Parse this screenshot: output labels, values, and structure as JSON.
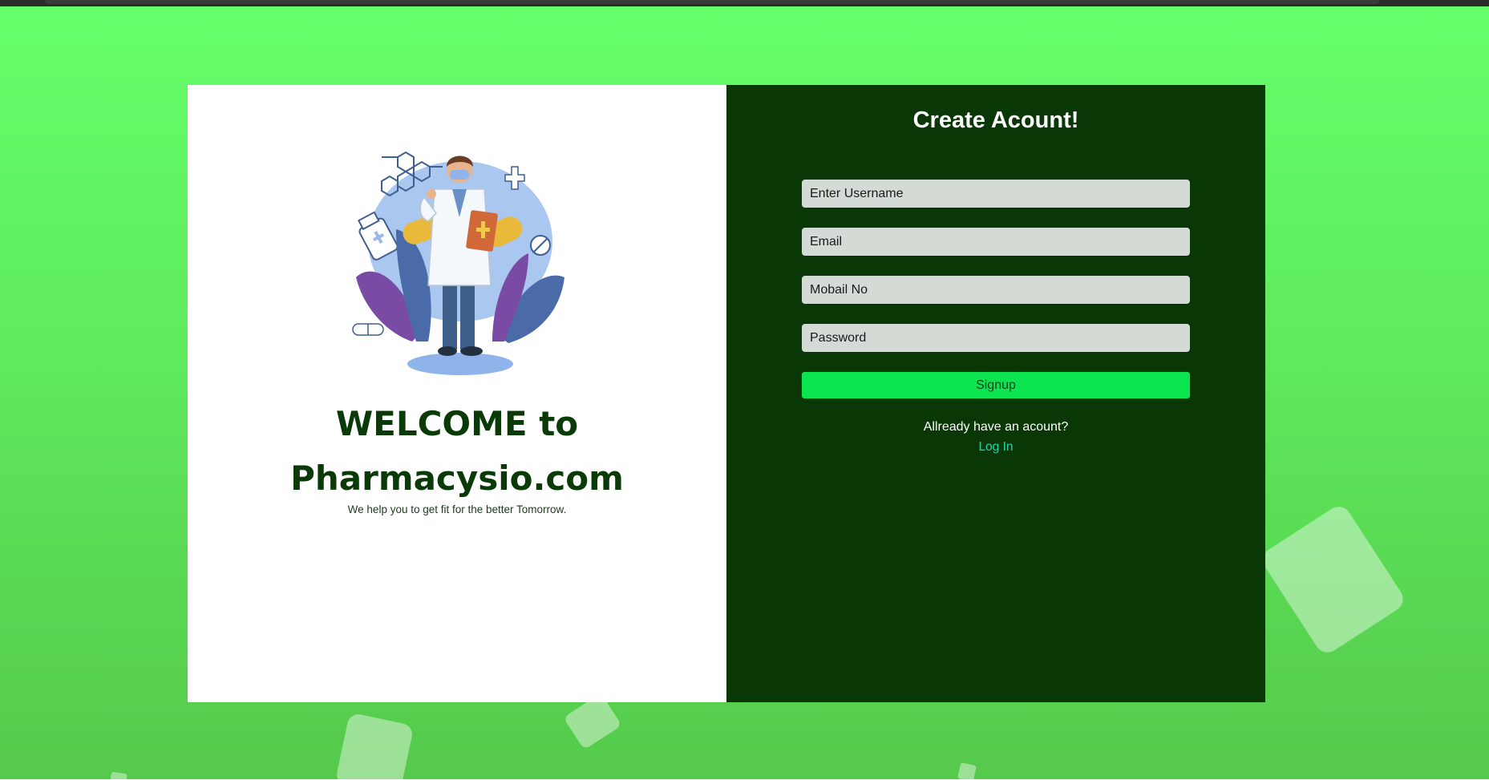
{
  "welcome": {
    "line1": "WELCOME to",
    "line2": "Pharmacysio.com",
    "tagline": "We help you to get fit for the better Tomorrow."
  },
  "form": {
    "title": "Create Acount!",
    "username_placeholder": "Enter Username",
    "email_placeholder": "Email",
    "mobile_placeholder": "Mobail No",
    "password_placeholder": "Password",
    "submit_label": "Signup",
    "have_account_text": "Allready have an acount?",
    "login_link": "Log In"
  },
  "colors": {
    "background_top": "#66ff6a",
    "background_bottom": "#55c94c",
    "form_panel": "#093806",
    "heading": "#0a3a08",
    "button": "#0ce54f",
    "link": "#22d3b0"
  },
  "icons": {
    "illustration": "pharmacist-illustration"
  }
}
